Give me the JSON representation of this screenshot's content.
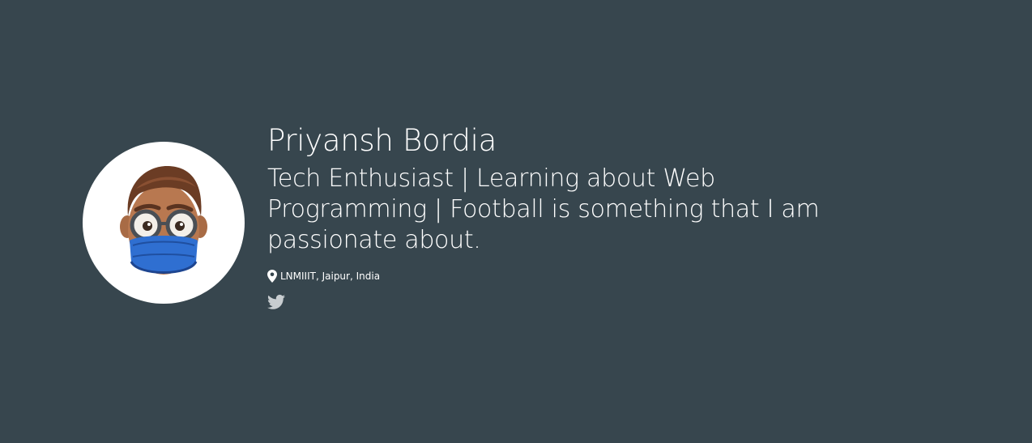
{
  "profile": {
    "name": "Priyansh Bordia",
    "bio": "Tech Enthusiast | Learning about Web Programming | Football is something that I am passionate about.",
    "location": "LNMIIIT, Jaipur, India",
    "avatar_icon": "memoji-avatar-icon",
    "location_icon": "map-pin-icon"
  },
  "social": {
    "links": [
      {
        "icon": "twitter-icon"
      }
    ]
  },
  "colors": {
    "background": "#37464e",
    "text": "#ffffff",
    "icon": "#c8cdd0",
    "mask": "#2f6fd1"
  }
}
